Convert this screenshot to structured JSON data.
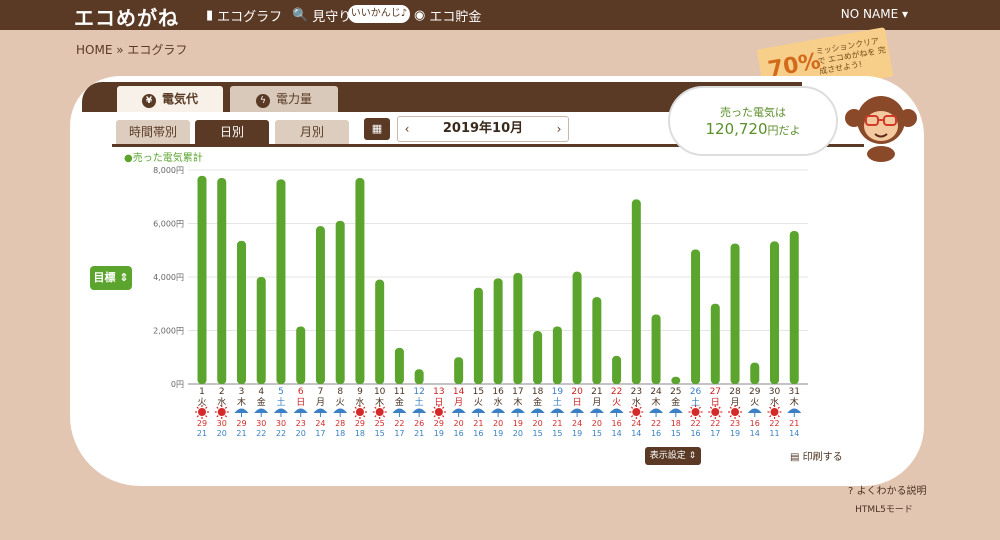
{
  "header": {
    "logo": "エコめがね",
    "nav": [
      "エコグラフ",
      "見守り",
      "エコ貯金"
    ],
    "badge": "いいかんじ♪",
    "user": "NO NAME ▾"
  },
  "breadcrumb": "HOME » エコグラフ",
  "mission": {
    "percent": "70%",
    "text": "ミッションクリアで エコめがねを 完成させよう!"
  },
  "tabs": {
    "main": [
      "電気代",
      "電力量"
    ],
    "sub": [
      "時間帯別",
      "日別",
      "月別"
    ]
  },
  "month": {
    "label": "2019年10月",
    "prev": "‹",
    "next": "›"
  },
  "bubble": {
    "line1": "売った電気は",
    "value": "120,720",
    "unit": "円だよ"
  },
  "target_button": "目標 ⇕",
  "display_settings": "表示設定 ⇕",
  "print": "印刷する",
  "help": "よくわかる説明",
  "html5": "HTML5モード",
  "chart_data": {
    "type": "bar",
    "legend": "●売った電気累計",
    "ylim": [
      0,
      8000
    ],
    "yticks": [
      "0円",
      "2,000円",
      "4,000円",
      "6,000円",
      "8,000円"
    ],
    "bar_color": "#5ba42e",
    "categories": [
      "1",
      "2",
      "3",
      "4",
      "5",
      "6",
      "7",
      "8",
      "9",
      "10",
      "11",
      "12",
      "13",
      "14",
      "15",
      "16",
      "17",
      "18",
      "19",
      "20",
      "21",
      "22",
      "23",
      "24",
      "25",
      "26",
      "27",
      "28",
      "29",
      "30",
      "31"
    ],
    "weekdays": [
      "火",
      "水",
      "木",
      "金",
      "土",
      "日",
      "月",
      "火",
      "水",
      "木",
      "金",
      "土",
      "日",
      "月",
      "火",
      "水",
      "木",
      "金",
      "土",
      "日",
      "月",
      "火",
      "水",
      "木",
      "金",
      "土",
      "日",
      "月",
      "火",
      "水",
      "木"
    ],
    "day_colors": [
      "#4a3322",
      "#4a3322",
      "#4a3322",
      "#4a3322",
      "#3b7fc4",
      "#cc2222",
      "#4a3322",
      "#4a3322",
      "#4a3322",
      "#4a3322",
      "#4a3322",
      "#3b7fc4",
      "#cc2222",
      "#cc2222",
      "#4a3322",
      "#4a3322",
      "#4a3322",
      "#4a3322",
      "#3b7fc4",
      "#cc2222",
      "#4a3322",
      "#cc2222",
      "#4a3322",
      "#4a3322",
      "#4a3322",
      "#3b7fc4",
      "#cc2222",
      "#4a3322",
      "#4a3322",
      "#4a3322",
      "#4a3322"
    ],
    "weather": [
      "sun",
      "sun",
      "rain",
      "rain",
      "rain",
      "rain",
      "rain",
      "rain",
      "sun",
      "sun",
      "rain",
      "rain",
      "sun",
      "rain",
      "rain",
      "rain",
      "rain",
      "rain",
      "rain",
      "rain",
      "rain",
      "rain",
      "sun",
      "rain",
      "rain",
      "sun",
      "sun",
      "sun",
      "rain",
      "sun",
      "rain"
    ],
    "high_temps": [
      "29",
      "30",
      "29",
      "30",
      "30",
      "23",
      "24",
      "28",
      "29",
      "25",
      "22",
      "26",
      "29",
      "20",
      "21",
      "20",
      "19",
      "20",
      "21",
      "24",
      "20",
      "16",
      "24",
      "22",
      "18",
      "22",
      "22",
      "23",
      "16",
      "22",
      "21"
    ],
    "low_temps": [
      "21",
      "20",
      "21",
      "22",
      "22",
      "20",
      "17",
      "18",
      "18",
      "15",
      "17",
      "21",
      "19",
      "16",
      "16",
      "19",
      "20",
      "15",
      "15",
      "19",
      "15",
      "14",
      "14",
      "16",
      "15",
      "16",
      "17",
      "19",
      "14",
      "11",
      "14"
    ],
    "values": [
      7780,
      7700,
      5350,
      4000,
      7650,
      2150,
      5900,
      6100,
      7700,
      3900,
      1350,
      550,
      0,
      1000,
      3600,
      3950,
      4150,
      1980,
      2150,
      4200,
      3250,
      1050,
      6900,
      2600,
      270,
      5030,
      3000,
      5250,
      800,
      5330,
      5720
    ]
  }
}
